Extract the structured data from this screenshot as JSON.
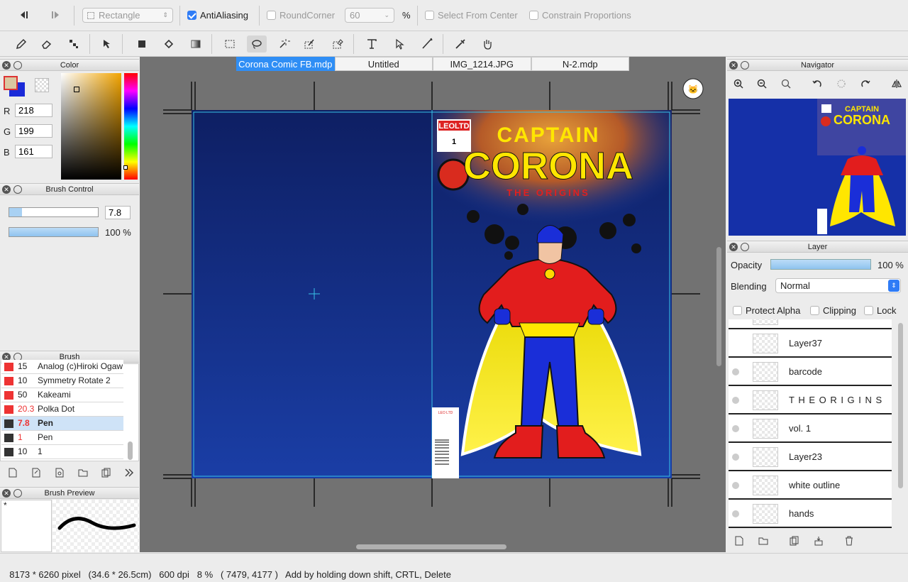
{
  "topbar": {
    "shape_select": "Rectangle",
    "antialiasing_label": "AntiAliasing",
    "roundcorner_label": "RoundCorner",
    "roundcorner_value": "60",
    "percent_label": "%",
    "select_from_center_label": "Select From Center",
    "constrain_label": "Constrain Proportions"
  },
  "tabs": [
    "Corona Comic FB.mdp",
    "Untitled",
    "IMG_1214.JPG",
    "N-2.mdp"
  ],
  "color_panel": {
    "title": "Color",
    "r_label": "R",
    "r_value": "218",
    "g_label": "G",
    "g_value": "199",
    "b_label": "B",
    "b_value": "161",
    "fg_color": "#dac7a1",
    "bg_color": "#1a2ad8"
  },
  "brush_control": {
    "title": "Brush Control",
    "size_value": "7.8",
    "opacity_value": "100 %"
  },
  "brush_panel": {
    "title": "Brush",
    "items": [
      {
        "size": "15",
        "name": "Analog (c)Hiroki Ogawa",
        "color": "#e33",
        "size_red": false
      },
      {
        "size": "10",
        "name": "Symmetry Rotate 2",
        "color": "#e33",
        "size_red": false
      },
      {
        "size": "50",
        "name": "Kakeami",
        "color": "#e33",
        "size_red": false
      },
      {
        "size": "20.3",
        "name": "Polka Dot",
        "color": "#e33",
        "size_red": true
      },
      {
        "size": "7.8",
        "name": "Pen",
        "color": "#333",
        "size_red": true
      },
      {
        "size": "1",
        "name": "Pen",
        "color": "#333",
        "size_red": true
      },
      {
        "size": "10",
        "name": "1",
        "color": "#333",
        "size_red": false
      }
    ]
  },
  "brush_preview": {
    "title": "Brush Preview",
    "marker": "*"
  },
  "navigator": {
    "title": "Navigator"
  },
  "layer_panel": {
    "title": "Layer",
    "opacity_label": "Opacity",
    "opacity_value": "100 %",
    "blending_label": "Blending",
    "blending_value": "Normal",
    "protect_alpha": "Protect Alpha",
    "clipping": "Clipping",
    "lock": "Lock",
    "layers": [
      "Layer37",
      "barcode",
      "T H E   O R I G I N S",
      "vol. 1",
      "Layer23",
      "white outline",
      "hands"
    ]
  },
  "cover": {
    "publisher": "LEOLTD",
    "issue": "1",
    "title_line1": "CAPTAIN",
    "title_line2": "CORONA",
    "subtitle": "THE  ORIGINS",
    "barcode_text": "LEO LTD"
  },
  "status": {
    "text": "8173 * 6260 pixel   (34.6 * 26.5cm)   600 dpi   8 %   ( 7479, 4177 )   Add by holding down shift, CRTL, Delete"
  }
}
